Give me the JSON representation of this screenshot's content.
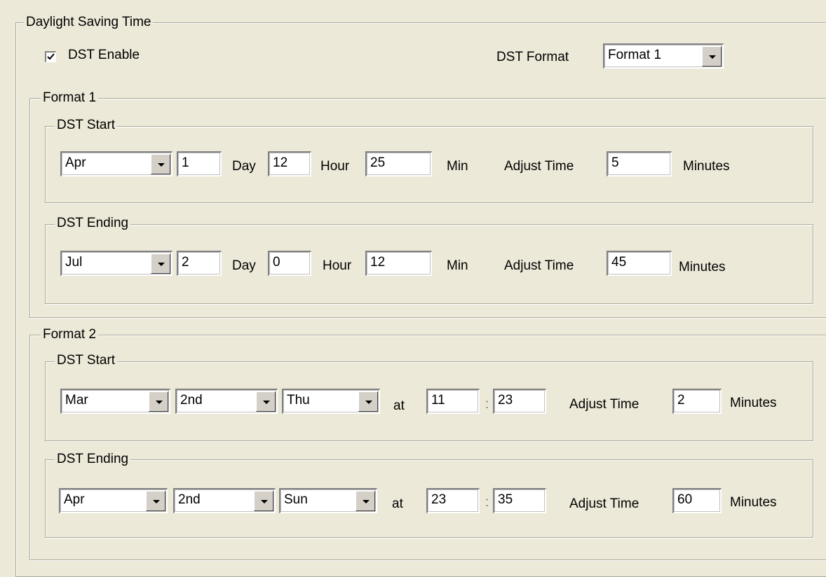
{
  "dst": {
    "group_title": "Daylight Saving Time",
    "enable_label": "DST Enable",
    "enable_checked": true,
    "format_label": "DST Format",
    "format_value": "Format 1"
  },
  "format1": {
    "title": "Format 1",
    "start": {
      "title": "DST Start",
      "month": "Apr",
      "day": "1",
      "day_label": "Day",
      "hour": "12",
      "hour_label": "Hour",
      "min": "25",
      "min_label": "Min",
      "adjust_label": "Adjust Time",
      "adjust": "5",
      "minutes_label": "Minutes"
    },
    "ending": {
      "title": "DST Ending",
      "month": "Jul",
      "day": "2",
      "day_label": "Day",
      "hour": "0",
      "hour_label": "Hour",
      "min": "12",
      "min_label": "Min",
      "adjust_label": "Adjust Time",
      "adjust": "45",
      "minutes_label": "Minutes"
    }
  },
  "format2": {
    "title": "Format 2",
    "start": {
      "title": "DST Start",
      "month": "Mar",
      "week": "2nd",
      "weekday": "Thu",
      "at_label": "at",
      "hour": "11",
      "colon": ":",
      "min": "23",
      "adjust_label": "Adjust Time",
      "adjust": "2",
      "minutes_label": "Minutes"
    },
    "ending": {
      "title": "DST Ending",
      "month": "Apr",
      "week": "2nd",
      "weekday": "Sun",
      "at_label": "at",
      "hour": "23",
      "colon": ":",
      "min": "35",
      "adjust_label": "Adjust Time",
      "adjust": "60",
      "minutes_label": "Minutes"
    }
  },
  "colors": {
    "background": "#ECE9D8",
    "frame": "#ACA899"
  }
}
